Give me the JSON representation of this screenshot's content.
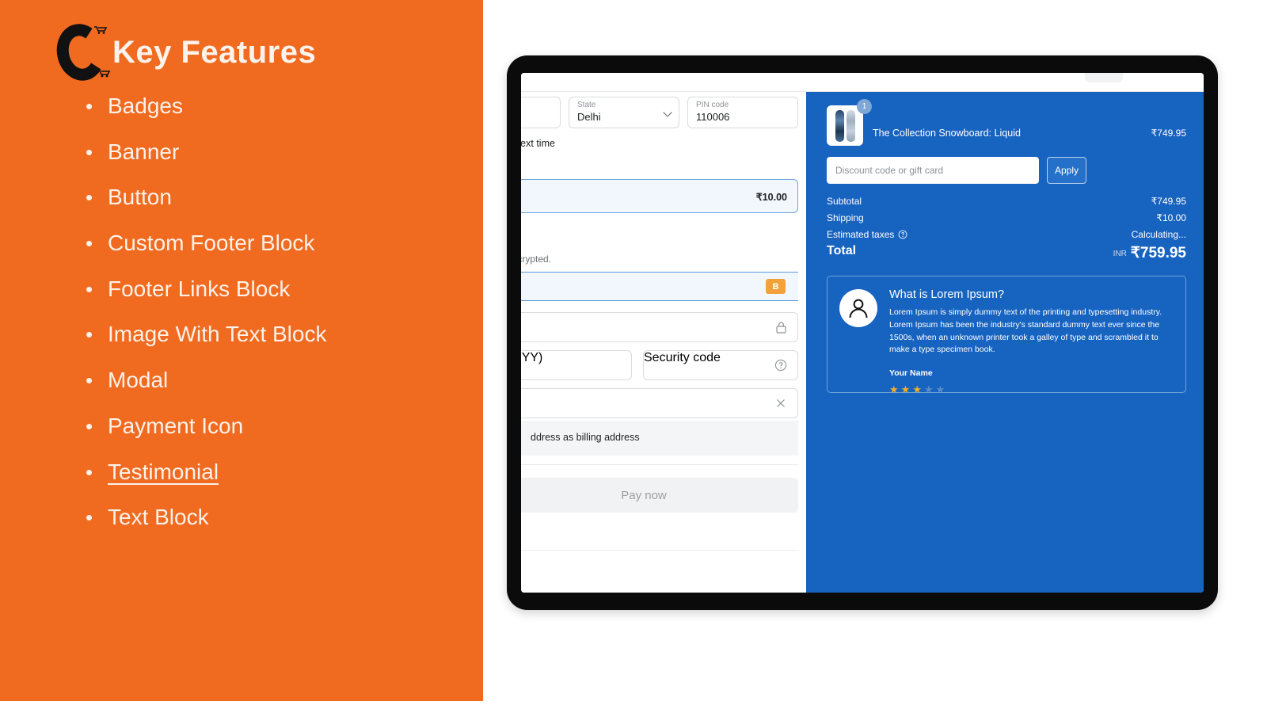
{
  "left_panel": {
    "bg_color": "#F06A20",
    "logo_icon": "c-cart-logo-icon",
    "title": "Key Features",
    "features": [
      {
        "label": "Badges",
        "highlighted": false
      },
      {
        "label": "Banner",
        "highlighted": false
      },
      {
        "label": "Button",
        "highlighted": false
      },
      {
        "label": "Custom Footer Block",
        "highlighted": false
      },
      {
        "label": "Footer Links Block",
        "highlighted": false
      },
      {
        "label": "Image With Text Block",
        "highlighted": false
      },
      {
        "label": "Modal",
        "highlighted": false
      },
      {
        "label": "Payment Icon",
        "highlighted": false
      },
      {
        "label": "Testimonial",
        "highlighted": true
      },
      {
        "label": "Text Block",
        "highlighted": false
      }
    ],
    "bullet": "•"
  },
  "checkout": {
    "accent_blue": "#1763C0",
    "form": {
      "city_field": {
        "label": "",
        "value": ""
      },
      "state_field": {
        "label": "State",
        "value": "Delhi",
        "chevron": "chevron-down-icon"
      },
      "pin_field": {
        "label": "PIN code",
        "value": "110006"
      },
      "save_note": "ion for next time",
      "shipping_option_amount": "₹10.00",
      "security_note": "ure and encrypted.",
      "card_brand_badge": "B",
      "card_number_icon": "lock-icon",
      "expiry_placeholder": "MM / YY)",
      "security_code_placeholder": "Security code",
      "security_code_icon": "help-circle-icon",
      "name_clear_icon": "close-x-icon",
      "billing_note": "ddress as billing address",
      "pay_button": "Pay now"
    },
    "summary": {
      "product": {
        "name": "The Collection Snowboard: Liquid",
        "price": "₹749.95",
        "quantity": "1",
        "thumbnail_icon": "snowboard-thumbnail-icon"
      },
      "discount_placeholder": "Discount code or gift card",
      "apply_button": "Apply",
      "rows": [
        {
          "label": "Subtotal",
          "value": "₹749.95"
        },
        {
          "label": "Shipping",
          "value": "₹10.00"
        },
        {
          "label": "Estimated taxes",
          "value": "Calculating...",
          "icon": "help-circle-icon"
        }
      ],
      "total": {
        "label": "Total",
        "currency": "INR",
        "value": "₹759.95"
      }
    },
    "testimonial": {
      "avatar_icon": "user-avatar-icon",
      "heading": "What is Lorem Ipsum?",
      "body": "Lorem Ipsum is simply dummy text of the printing and typesetting industry. Lorem Ipsum has been the industry's standard dummy text ever since the 1500s, when an unknown printer took a galley of type and scrambled it to make a type specimen book.",
      "author": "Your Name",
      "rating": 3,
      "rating_max": 5,
      "star_glyph": "★",
      "star_on_color": "#F4B024",
      "star_off_color": "#5A8DC8"
    }
  }
}
